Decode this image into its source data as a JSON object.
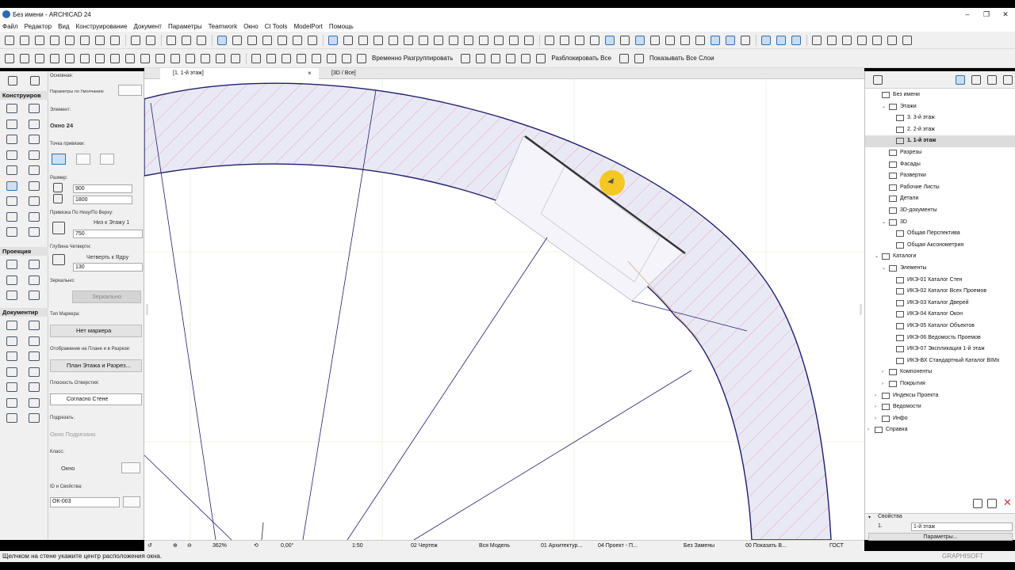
{
  "window": {
    "title": "Без имени - ARCHICAD 24",
    "minimize": "–",
    "maximize": "❐",
    "close": "✕"
  },
  "menu": [
    "Файл",
    "Редактор",
    "Вид",
    "Конструирование",
    "Документ",
    "Параметры",
    "Teamwork",
    "Окно",
    "CI Tools",
    "ModelPort",
    "Помощь"
  ],
  "toolbar2": {
    "ungroup_label": "Временно Разгруппировать",
    "unlock_label": "Разблокировать Все",
    "show_layers_label": "Показывать Все Слои"
  },
  "toolbox": {
    "main": "Основная:",
    "design": "Конструиров",
    "view": "Проекция",
    "document": "Документир"
  },
  "tabs": {
    "plan": "[1. 1-й этаж]",
    "view3d": "[3D / Все]"
  },
  "info": {
    "main_label": "Основная:",
    "default_params": "Параметры по Умолчанию",
    "element_label": "Элемент:",
    "element_value": "Окно 24",
    "anchor_label": "Точка привязки:",
    "size_label": "Размер:",
    "width": "900",
    "height": "1800",
    "sill_label": "Привязка По Низу/По Верху:",
    "sill_mode": "Низ к Этажу 1",
    "sill_value": "750",
    "reveal_label": "Глубина Четверти:",
    "reveal_mode": "Четверть к Ядру",
    "reveal_value": "130",
    "mirror_label": "Зеркально:",
    "mirror_btn": "Зеркально",
    "marker_label": "Тип Маркера:",
    "marker_value": "Нет маркера",
    "display_label": "Отображение на Плане и в Разрезе:",
    "display_value": "План Этажа и Разрез...",
    "plane_label": "Плоскость Отверстия:",
    "plane_value": "Согласно Стене",
    "cut_label": "Подрезать:",
    "cut_value": "Окно Подрезано",
    "class_label": "Класс:",
    "class_value": "Окно",
    "id_label": "ID и Свойства:",
    "id_value": "ОК-003"
  },
  "status": {
    "zoom": "362%",
    "angle": "0,00°",
    "scale": "1:50",
    "layers": "02 Чертеж",
    "model": "Вся Модель",
    "pen": "01 Архитектур...",
    "mvo": "04 Проект - П...",
    "renovation": "Без Замены",
    "graphic": "00 Показать В...",
    "standard": "ГОСТ"
  },
  "hint": "Щелчком на стене укажите центр расположения окна.",
  "watermark": "GRAPHISOFT",
  "navigator": [
    {
      "label": "Без имени",
      "level": 0,
      "toggle": ""
    },
    {
      "label": "Этажи",
      "level": 1,
      "toggle": "⌄"
    },
    {
      "label": "3. 3-й этаж",
      "level": 2,
      "toggle": ""
    },
    {
      "label": "2. 2-й этаж",
      "level": 2,
      "toggle": ""
    },
    {
      "label": "1. 1-й этаж",
      "level": 2,
      "toggle": "",
      "selected": true
    },
    {
      "label": "Разрезы",
      "level": 1,
      "toggle": ""
    },
    {
      "label": "Фасады",
      "level": 1,
      "toggle": ""
    },
    {
      "label": "Развертки",
      "level": 1,
      "toggle": ""
    },
    {
      "label": "Рабочие Листы",
      "level": 1,
      "toggle": ""
    },
    {
      "label": "Детали",
      "level": 1,
      "toggle": ""
    },
    {
      "label": "3D-документы",
      "level": 1,
      "toggle": ""
    },
    {
      "label": "3D",
      "level": 1,
      "toggle": "⌄"
    },
    {
      "label": "Общая Перспектива",
      "level": 2,
      "toggle": ""
    },
    {
      "label": "Общая Аксонометрия",
      "level": 2,
      "toggle": ""
    },
    {
      "label": "Каталоги",
      "level": 0,
      "toggle": "⌄"
    },
    {
      "label": "Элементы",
      "level": 1,
      "toggle": "⌄"
    },
    {
      "label": "ИКЭ-01 Каталог Стен",
      "level": 2,
      "toggle": ""
    },
    {
      "label": "ИКЭ-02 Каталог Всех Проемов",
      "level": 2,
      "toggle": ""
    },
    {
      "label": "ИКЭ-03 Каталог Дверей",
      "level": 2,
      "toggle": ""
    },
    {
      "label": "ИКЭ-04 Каталог Окон",
      "level": 2,
      "toggle": ""
    },
    {
      "label": "ИКЭ-05 Каталог Объектов",
      "level": 2,
      "toggle": ""
    },
    {
      "label": "ИКЭ-06 Ведомость Проемов",
      "level": 2,
      "toggle": ""
    },
    {
      "label": "ИКЭ-07 Экспликация 1-й этаж",
      "level": 2,
      "toggle": ""
    },
    {
      "label": "ИКЭ-ВХ Стандартный Каталог BIMx",
      "level": 2,
      "toggle": ""
    },
    {
      "label": "Компоненты",
      "level": 1,
      "toggle": "›"
    },
    {
      "label": "Покрытия",
      "level": 1,
      "toggle": "›"
    },
    {
      "label": "Индексы Проекта",
      "level": 0,
      "toggle": "›"
    },
    {
      "label": "Ведомости",
      "level": 0,
      "toggle": "›"
    },
    {
      "label": "Инфо",
      "level": 0,
      "toggle": "›"
    },
    {
      "label": "Справка",
      "level": -1,
      "toggle": "›"
    }
  ],
  "properties": {
    "header": "Свойства",
    "id": "1.",
    "name": "1-й этаж",
    "params_btn": "Параметры..."
  },
  "colors": {
    "hatch_fill": "#e8e8f4",
    "hatch_line": "#e06a7a",
    "wall_edge": "#1e1e6e",
    "highlight": "#f5c518",
    "grid": "#f0ecd0"
  }
}
